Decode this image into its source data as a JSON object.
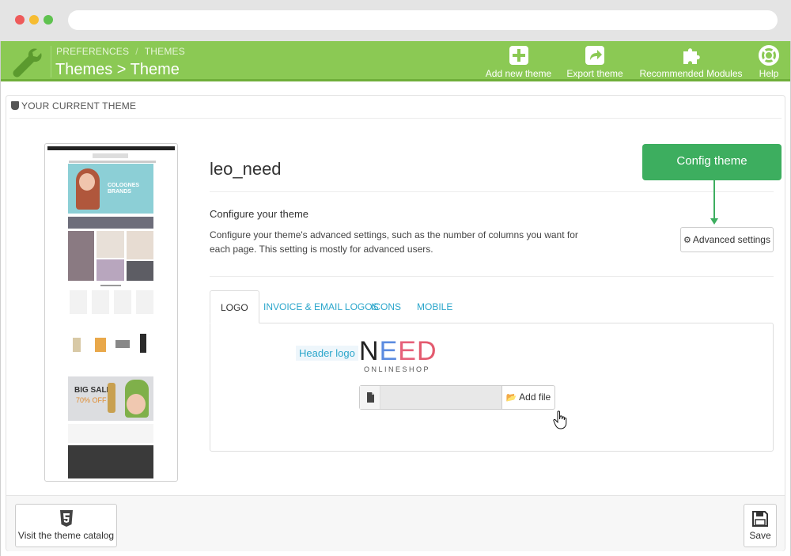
{
  "toolbar": {
    "breadcrumb": [
      "PREFERENCES",
      "THEMES"
    ],
    "breadcrumb_sep": "/",
    "title": "Themes > Theme",
    "buttons": [
      {
        "label": "Add new theme",
        "icon": "plus-square-icon"
      },
      {
        "label": "Export theme",
        "icon": "share-square-icon"
      },
      {
        "label": "Recommended Modules",
        "icon": "puzzle-icon"
      },
      {
        "label": "Help",
        "icon": "lifebuoy-icon"
      }
    ]
  },
  "panel": {
    "heading": "YOUR CURRENT THEME",
    "theme_name": "leo_need",
    "configure_title": "Configure your theme",
    "configure_desc": "Configure your theme's advanced settings, such as the number of columns you want for each page. This setting is mostly for advanced users.",
    "advanced_button": "Advanced settings",
    "callout": "Config theme",
    "tabs": [
      "LOGO",
      "INVOICE & EMAIL LOGOS",
      "ICONS",
      "MOBILE"
    ],
    "active_tab": "LOGO",
    "header_logo_label": "Header logo",
    "logo": {
      "letters": [
        "N",
        "E",
        "E",
        "D"
      ],
      "letter_colors": [
        "#222222",
        "#5b8be0",
        "#e6607a",
        "#e35a6e"
      ],
      "sub": "ONLINESHOP"
    },
    "add_file_label": "Add file"
  },
  "preview": {
    "banner_text": "COLOGNES BRANDS",
    "sale_text": "BIG SALE",
    "sale_sub": "70% OFF"
  },
  "footer": {
    "visit_label": "Visit the theme catalog",
    "save_label": "Save"
  },
  "colors": {
    "toolbar": "#8bc954",
    "link": "#2ba6cb",
    "callout": "#3dae5f"
  }
}
